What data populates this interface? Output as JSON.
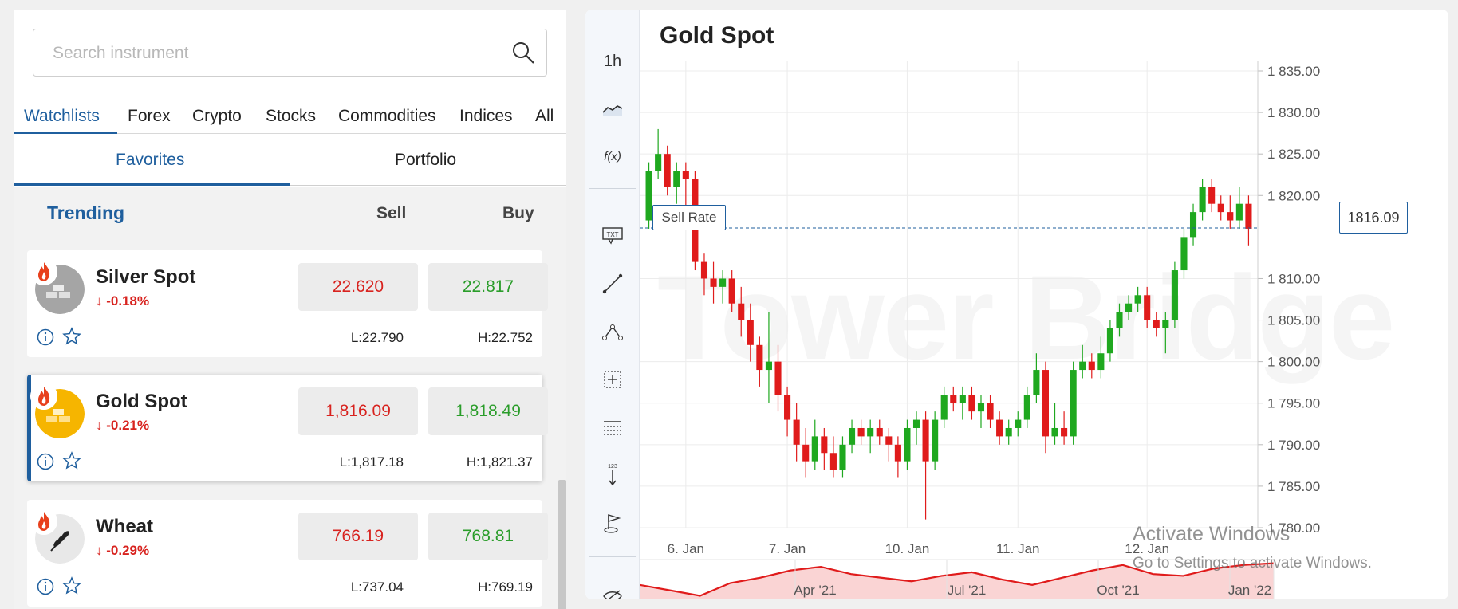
{
  "search": {
    "placeholder": "Search instrument"
  },
  "categories": {
    "tabs": [
      "Watchlists",
      "Forex",
      "Crypto",
      "Stocks",
      "Commodities",
      "Indices",
      "All"
    ],
    "active": "Watchlists"
  },
  "subtabs": {
    "items": [
      "Favorites",
      "Portfolio"
    ],
    "active": "Favorites"
  },
  "list": {
    "header": {
      "trending": "Trending",
      "sell": "Sell",
      "buy": "Buy"
    },
    "instruments": [
      {
        "name": "Silver Spot",
        "change": "-0.18%",
        "sell": "22.620",
        "buy": "22.817",
        "low": "L:22.790",
        "high": "H:22.752",
        "icon": "silver-bars-icon",
        "color": "#9e9e9e"
      },
      {
        "name": "Gold Spot",
        "change": "-0.21%",
        "sell": "1,816.09",
        "buy": "1,818.49",
        "low": "L:1,817.18",
        "high": "H:1,821.37",
        "icon": "gold-bars-icon",
        "color": "#f6b500",
        "selected": true
      },
      {
        "name": "Wheat",
        "change": "-0.29%",
        "sell": "766.19",
        "buy": "768.81",
        "low": "L:737.04",
        "high": "H:769.19",
        "icon": "wheat-icon",
        "color": "#e8e8e8"
      }
    ]
  },
  "chart": {
    "title": "Gold Spot",
    "timeframe": "1h",
    "fx_label": "f(x)",
    "txt_label": "TXT",
    "sell_rate_label": "Sell Rate",
    "current_rate": "1816.09",
    "watermark": "Tower Bridge",
    "overlay_line1": "Activate Windows",
    "overlay_line2": "Go to Settings to activate Windows.",
    "tools": [
      "1h-button",
      "line-chart-icon",
      "function-icon",
      "text-note-icon",
      "trend-line-icon",
      "path-icon",
      "crosshair-icon",
      "grid-icon",
      "measure-icon",
      "flag-icon",
      "hide-icon"
    ]
  },
  "chart_data": {
    "type": "candlestick",
    "title": "Gold Spot",
    "ylim": [
      1780,
      1835
    ],
    "y_ticks": [
      "1 835.00",
      "1 830.00",
      "1 825.00",
      "1 820.00",
      "1 816.09",
      "1 810.00",
      "1 805.00",
      "1 800.00",
      "1 795.00",
      "1 790.00",
      "1 785.00",
      "1 780.00"
    ],
    "y_tick_values": [
      1835,
      1830,
      1825,
      1820,
      1816.09,
      1810,
      1805,
      1800,
      1795,
      1790,
      1785,
      1780
    ],
    "x_ticks": [
      "6. Jan",
      "7. Jan",
      "10. Jan",
      "11. Jan",
      "12. Jan"
    ],
    "current_price": 1816.09,
    "candles": [
      [
        1817,
        1824,
        1816,
        1823
      ],
      [
        1823,
        1828,
        1822,
        1825
      ],
      [
        1825,
        1826,
        1820,
        1821
      ],
      [
        1821,
        1824,
        1819,
        1823
      ],
      [
        1823,
        1824,
        1818,
        1822
      ],
      [
        1822,
        1823,
        1811,
        1812
      ],
      [
        1812,
        1813,
        1808,
        1810
      ],
      [
        1810,
        1812,
        1807,
        1809
      ],
      [
        1809,
        1811,
        1807,
        1810
      ],
      [
        1810,
        1811,
        1806,
        1807
      ],
      [
        1807,
        1809,
        1803,
        1805
      ],
      [
        1805,
        1807,
        1800,
        1802
      ],
      [
        1802,
        1803,
        1797,
        1799
      ],
      [
        1799,
        1806,
        1795,
        1800
      ],
      [
        1800,
        1802,
        1794,
        1796
      ],
      [
        1796,
        1797,
        1791,
        1793
      ],
      [
        1793,
        1795,
        1788,
        1790
      ],
      [
        1790,
        1792,
        1786,
        1788
      ],
      [
        1788,
        1793,
        1787,
        1791
      ],
      [
        1791,
        1792,
        1787,
        1789
      ],
      [
        1789,
        1791,
        1786,
        1787
      ],
      [
        1787,
        1791,
        1786,
        1790
      ],
      [
        1790,
        1793,
        1789,
        1792
      ],
      [
        1792,
        1793,
        1790,
        1791
      ],
      [
        1791,
        1793,
        1789,
        1792
      ],
      [
        1792,
        1793,
        1790,
        1791
      ],
      [
        1791,
        1792,
        1788,
        1790
      ],
      [
        1790,
        1791,
        1786,
        1788
      ],
      [
        1788,
        1793,
        1787,
        1792
      ],
      [
        1792,
        1794,
        1790,
        1793
      ],
      [
        1793,
        1794,
        1781,
        1788
      ],
      [
        1788,
        1794,
        1787,
        1793
      ],
      [
        1793,
        1797,
        1792,
        1796
      ],
      [
        1796,
        1797,
        1794,
        1795
      ],
      [
        1795,
        1797,
        1793,
        1796
      ],
      [
        1796,
        1797,
        1793,
        1794
      ],
      [
        1794,
        1796,
        1792,
        1795
      ],
      [
        1795,
        1796,
        1792,
        1793
      ],
      [
        1793,
        1794,
        1790,
        1791
      ],
      [
        1791,
        1793,
        1790,
        1792
      ],
      [
        1792,
        1794,
        1791,
        1793
      ],
      [
        1793,
        1797,
        1792,
        1796
      ],
      [
        1796,
        1801,
        1795,
        1799
      ],
      [
        1799,
        1800,
        1789,
        1791
      ],
      [
        1791,
        1795,
        1790,
        1792
      ],
      [
        1792,
        1794,
        1790,
        1791
      ],
      [
        1791,
        1800,
        1790,
        1799
      ],
      [
        1799,
        1802,
        1798,
        1800
      ],
      [
        1800,
        1801,
        1798,
        1799
      ],
      [
        1799,
        1803,
        1798,
        1801
      ],
      [
        1801,
        1805,
        1800,
        1804
      ],
      [
        1804,
        1807,
        1803,
        1806
      ],
      [
        1806,
        1808,
        1805,
        1807
      ],
      [
        1807,
        1809,
        1806,
        1808
      ],
      [
        1808,
        1809,
        1804,
        1805
      ],
      [
        1805,
        1806,
        1803,
        1804
      ],
      [
        1804,
        1806,
        1801,
        1805
      ],
      [
        1805,
        1812,
        1804,
        1811
      ],
      [
        1811,
        1816,
        1810,
        1815
      ],
      [
        1815,
        1819,
        1814,
        1818
      ],
      [
        1818,
        1822,
        1817,
        1821
      ],
      [
        1821,
        1822,
        1818,
        1819
      ],
      [
        1819,
        1820,
        1817,
        1818
      ],
      [
        1818,
        1820,
        1816,
        1817
      ],
      [
        1817,
        1821,
        1816,
        1819
      ],
      [
        1819,
        1820,
        1814,
        1816
      ]
    ],
    "navigator": {
      "labels": [
        "Apr '21",
        "Jul '21",
        "Oct '21",
        "Jan '22"
      ],
      "values": [
        1760,
        1745,
        1730,
        1765,
        1780,
        1800,
        1810,
        1790,
        1780,
        1770,
        1785,
        1795,
        1775,
        1760,
        1780,
        1800,
        1815,
        1790,
        1785,
        1805,
        1815,
        1820
      ]
    }
  }
}
